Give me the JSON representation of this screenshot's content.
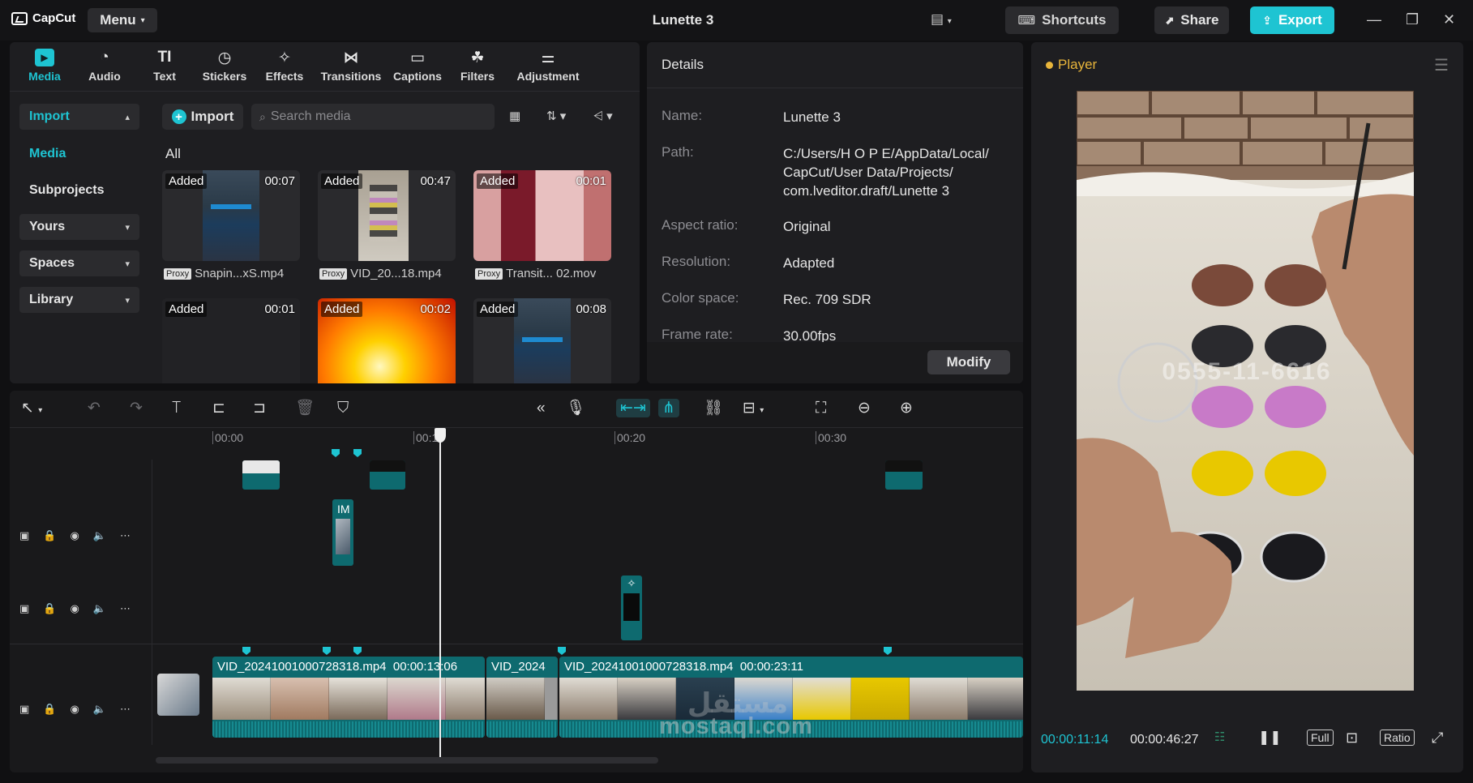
{
  "app": {
    "name": "CapCut",
    "menu_label": "Menu",
    "project_title": "Lunette 3"
  },
  "header": {
    "shortcuts_label": "Shortcuts",
    "share_label": "Share",
    "export_label": "Export"
  },
  "categories": [
    {
      "label": "Media",
      "icon": "media-icon"
    },
    {
      "label": "Audio",
      "icon": "audio-icon"
    },
    {
      "label": "Text",
      "icon": "text-icon"
    },
    {
      "label": "Stickers",
      "icon": "stickers-icon"
    },
    {
      "label": "Effects",
      "icon": "effects-icon"
    },
    {
      "label": "Transitions",
      "icon": "transitions-icon"
    },
    {
      "label": "Captions",
      "icon": "captions-icon"
    },
    {
      "label": "Filters",
      "icon": "filters-icon"
    },
    {
      "label": "Adjustment",
      "icon": "adjustment-icon"
    }
  ],
  "media_nav": [
    {
      "label": "Import"
    },
    {
      "label": "Media"
    },
    {
      "label": "Subprojects"
    },
    {
      "label": "Yours"
    },
    {
      "label": "Spaces"
    },
    {
      "label": "Library"
    }
  ],
  "media": {
    "import_label": "Import",
    "search_placeholder": "Search media",
    "filter_label": "All",
    "items": [
      {
        "status": "Added",
        "duration": "00:07",
        "proxy": "Proxy",
        "name": "Snapin...xS.mp4"
      },
      {
        "status": "Added",
        "duration": "00:47",
        "proxy": "Proxy",
        "name": "VID_20...18.mp4"
      },
      {
        "status": "Added",
        "duration": "00:01",
        "proxy": "Proxy",
        "name": "Transit... 02.mov"
      },
      {
        "status": "Added",
        "duration": "00:01"
      },
      {
        "status": "Added",
        "duration": "00:02"
      },
      {
        "status": "Added",
        "duration": "00:08"
      }
    ]
  },
  "details": {
    "heading": "Details",
    "rows": [
      {
        "key": "Name:",
        "value": "Lunette 3"
      },
      {
        "key": "Path:",
        "value": "C:/Users/H O P E/AppData/Local/ CapCut/User Data/Projects/ com.lveditor.draft/Lunette 3"
      },
      {
        "key": "Aspect ratio:",
        "value": "Original"
      },
      {
        "key": "Resolution:",
        "value": "Adapted"
      },
      {
        "key": "Color space:",
        "value": "Rec. 709 SDR"
      },
      {
        "key": "Frame rate:",
        "value": "30.00fps"
      }
    ],
    "modify_label": "Modify"
  },
  "player": {
    "title": "Player",
    "current_time": "00:00:11:14",
    "total_time": "00:00:46:27",
    "full_label": "Full",
    "ratio_label": "Ratio",
    "overlay_text": "0555-11-6616"
  },
  "timeline": {
    "ruler": [
      "00:00",
      "00:10",
      "00:20",
      "00:30"
    ],
    "small_clip_label": "IM",
    "main_clips": [
      {
        "name": "VID_20241001000728318.mp4",
        "duration": "00:00:13:06"
      },
      {
        "name": "VID_2024"
      },
      {
        "name": "VID_20241001000728318.mp4",
        "duration": "00:00:23:11"
      }
    ]
  },
  "watermark": {
    "arabic": "مستقل",
    "latin": "mostaql.com"
  },
  "colors": {
    "accent": "#1ec4d2",
    "panel": "#1e1e21",
    "clip": "#0e6a6f",
    "player_dot": "#e8b53b"
  }
}
